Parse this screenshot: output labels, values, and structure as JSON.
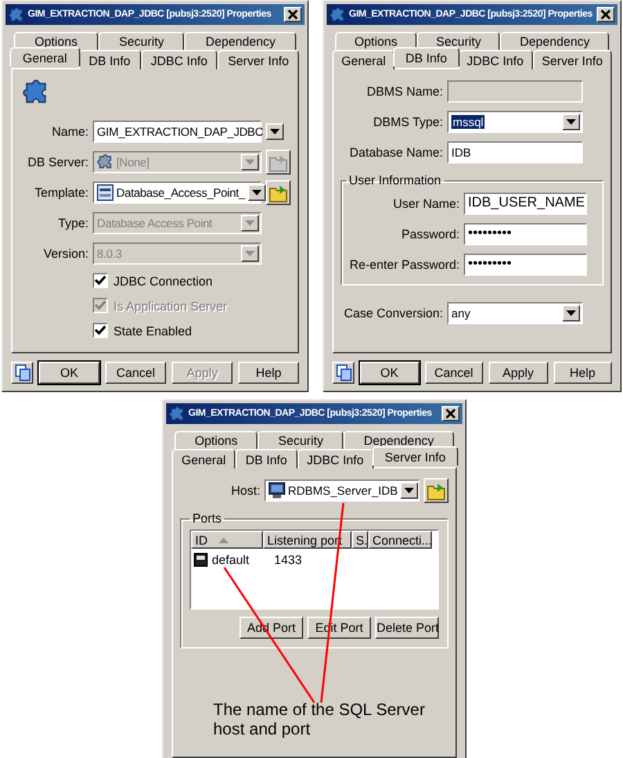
{
  "dialogs": [
    {
      "title": "GIM_EXTRACTION_DAP_JDBC [pubsj3:2520] Properties",
      "tab_rows": [
        [
          {
            "label": "Options",
            "selected": false
          },
          {
            "label": "Security",
            "selected": false
          },
          {
            "label": "Dependency",
            "selected": false
          }
        ],
        [
          {
            "label": "General",
            "selected": true
          },
          {
            "label": "DB Info",
            "selected": false
          },
          {
            "label": "JDBC Info",
            "selected": false
          },
          {
            "label": "Server Info",
            "selected": false
          }
        ]
      ],
      "items": [
        {
          "kind": "emblem"
        },
        {
          "kind": "combo",
          "label": "Name:",
          "value": "GIM_EXTRACTION_DAP_JDBC",
          "disabled": false,
          "highlighted": false
        },
        {
          "kind": "picker",
          "label": "DB Server:",
          "value": "[None]",
          "disabled": true,
          "highlighted": false
        },
        {
          "kind": "picker",
          "label": "Template:",
          "value": "Database_Access_Point_",
          "disabled": false,
          "highlighted": false
        },
        {
          "kind": "combo",
          "label": "Type:",
          "value": "Database Access Point",
          "disabled": true,
          "highlighted": false
        },
        {
          "kind": "combo",
          "label": "Version:",
          "value": "8.0.3",
          "disabled": true,
          "highlighted": false
        },
        {
          "kind": "check",
          "label": "JDBC Connection",
          "checked": true,
          "disabled": false
        },
        {
          "kind": "check",
          "label": "Is Application Server",
          "checked": true,
          "disabled": true
        },
        {
          "kind": "check",
          "label": "State Enabled",
          "checked": true,
          "disabled": false
        }
      ],
      "buttons": [
        {
          "label": "OK",
          "default": true,
          "disabled": false
        },
        {
          "label": "Cancel",
          "default": false,
          "disabled": false
        },
        {
          "label": "Apply",
          "default": false,
          "disabled": true
        },
        {
          "label": "Help",
          "default": false,
          "disabled": false
        }
      ]
    },
    {
      "title": "GIM_EXTRACTION_DAP_JDBC [pubsj3:2520] Properties",
      "tab_rows": [
        [
          {
            "label": "Options",
            "selected": false
          },
          {
            "label": "Security",
            "selected": false
          },
          {
            "label": "Dependency",
            "selected": false
          }
        ],
        [
          {
            "label": "General",
            "selected": false
          },
          {
            "label": "DB Info",
            "selected": true
          },
          {
            "label": "JDBC Info",
            "selected": false
          },
          {
            "label": "Server Info",
            "selected": false
          }
        ]
      ],
      "items": [
        {
          "kind": "text",
          "label": "DBMS Name:",
          "disabled": true,
          "highlighted": false
        },
        {
          "kind": "combo",
          "label": "DBMS Type:",
          "value": "mssql",
          "disabled": false,
          "highlighted": true
        },
        {
          "kind": "text",
          "label": "Database Name:",
          "value": "IDB",
          "disabled": false,
          "highlighted": false
        },
        {
          "kind": "group",
          "label": "User Information",
          "items": [
            {
              "kind": "text",
              "label": "User Name:",
              "value": "IDB_USER_NAME",
              "disabled": false,
              "highlighted": false
            },
            {
              "kind": "text",
              "label": "Password:",
              "value": "•••••••••",
              "disabled": false,
              "highlighted": false
            },
            {
              "kind": "text",
              "label": "Re-enter Password:",
              "value": "•••••••••",
              "disabled": false,
              "highlighted": false
            }
          ]
        },
        {
          "kind": "combo",
          "label": "Case Conversion:",
          "value": "any",
          "disabled": false,
          "highlighted": false
        }
      ],
      "buttons": [
        {
          "label": "OK",
          "default": true,
          "disabled": false
        },
        {
          "label": "Cancel",
          "default": false,
          "disabled": false
        },
        {
          "label": "Apply",
          "default": false,
          "disabled": false
        },
        {
          "label": "Help",
          "default": false,
          "disabled": false
        }
      ]
    },
    {
      "title": "GIM_EXTRACTION_DAP_JDBC [pubsj3:2520] Properties",
      "tab_rows": [
        [
          {
            "label": "Options",
            "selected": false
          },
          {
            "label": "Security",
            "selected": false
          },
          {
            "label": "Dependency",
            "selected": false
          }
        ],
        [
          {
            "label": "General",
            "selected": false
          },
          {
            "label": "DB Info",
            "selected": false
          },
          {
            "label": "JDBC Info",
            "selected": false
          },
          {
            "label": "Server Info",
            "selected": true
          }
        ]
      ],
      "items": [
        {
          "kind": "picker",
          "label": "Host:",
          "value": "RDBMS_Server_IDB",
          "disabled": false,
          "highlighted": false
        },
        {
          "kind": "group",
          "label": "Ports",
          "items": [
            {
              "kind": "list",
              "columns": [
                "ID",
                "Listening port",
                "S.",
                "Connecti..."
              ],
              "rows": [
                [
                  "default",
                  "1433"
                ]
              ]
            },
            {
              "kind": "actions",
              "buttons": [
                "Add Port",
                "Edit Port",
                "Delete Port"
              ]
            }
          ]
        },
        {
          "kind": "note",
          "text": "The name of the SQL Server host and port"
        }
      ]
    }
  ]
}
